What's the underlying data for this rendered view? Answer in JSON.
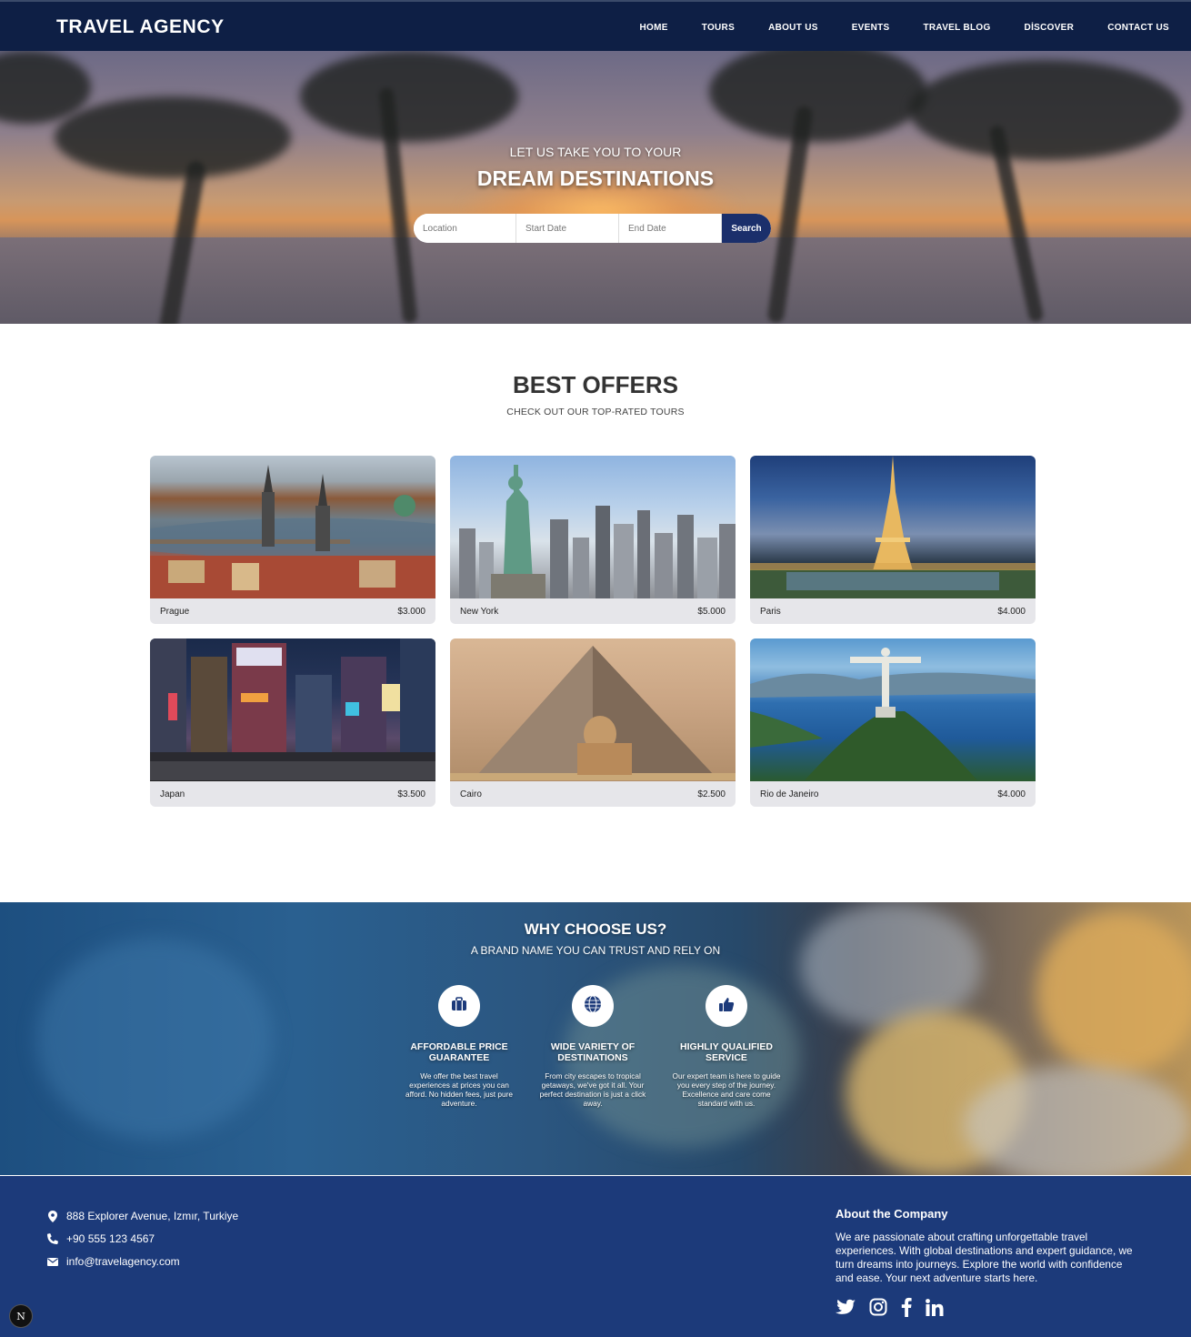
{
  "brand": "TRAVEL AGENCY",
  "nav": [
    "HOME",
    "TOURS",
    "ABOUT US",
    "EVENTS",
    "TRAVEL BLOG",
    "DİSCOVER",
    "CONTACT US"
  ],
  "hero": {
    "subtitle": "LET US TAKE YOU TO YOUR",
    "title": "DREAM DESTINATIONS",
    "search": {
      "location_placeholder": "Location",
      "start_placeholder": "Start Date",
      "end_placeholder": "End Date",
      "button": "Search"
    }
  },
  "offers": {
    "title": "BEST OFFERS",
    "subtitle": "CHECK OUT OUR TOP-RATED TOURS",
    "cards": [
      {
        "name": "Prague",
        "price": "$3.000"
      },
      {
        "name": "New York",
        "price": "$5.000"
      },
      {
        "name": "Paris",
        "price": "$4.000"
      },
      {
        "name": "Japan",
        "price": "$3.500"
      },
      {
        "name": "Cairo",
        "price": "$2.500"
      },
      {
        "name": "Rio de Janeiro",
        "price": "$4.000"
      }
    ]
  },
  "why": {
    "title": "WHY CHOOSE US?",
    "subtitle": "A BRAND NAME YOU CAN TRUST AND RELY ON",
    "features": [
      {
        "icon": "briefcase-icon",
        "title": "AFFORDABLE PRICE GUARANTEE",
        "desc": "We offer the best travel experiences at prices you can afford. No hidden fees, just pure adventure."
      },
      {
        "icon": "globe-icon",
        "title": "WIDE VARIETY OF DESTINATIONS",
        "desc": "From city escapes to tropical getaways, we've got it all. Your perfect destination is just a click away."
      },
      {
        "icon": "thumbs-up-icon",
        "title": "HIGHLIY QUALIFIED SERVICE",
        "desc": "Our expert team is here to guide you every step of the journey. Excellence and care come standard with us."
      }
    ]
  },
  "footer": {
    "address": "888 Explorer Avenue, Izmır, Turkiye",
    "phone": "+90 555 123 4567",
    "email": "info@travelagency.com",
    "about_title": "About the Company",
    "about_text": "We are passionate about crafting unforgettable travel experiences. With global destinations and expert guidance, we turn dreams into journeys. Explore the world with confidence and ease. Your next adventure starts here.",
    "socials": [
      "twitter-icon",
      "instagram-icon",
      "facebook-icon",
      "linkedin-icon"
    ]
  },
  "badge": "N",
  "colors": {
    "navy": "#0e1f45",
    "button": "#1b2f6b",
    "footer": "#1c3a7a",
    "icon_blue": "#1c3a7a"
  }
}
